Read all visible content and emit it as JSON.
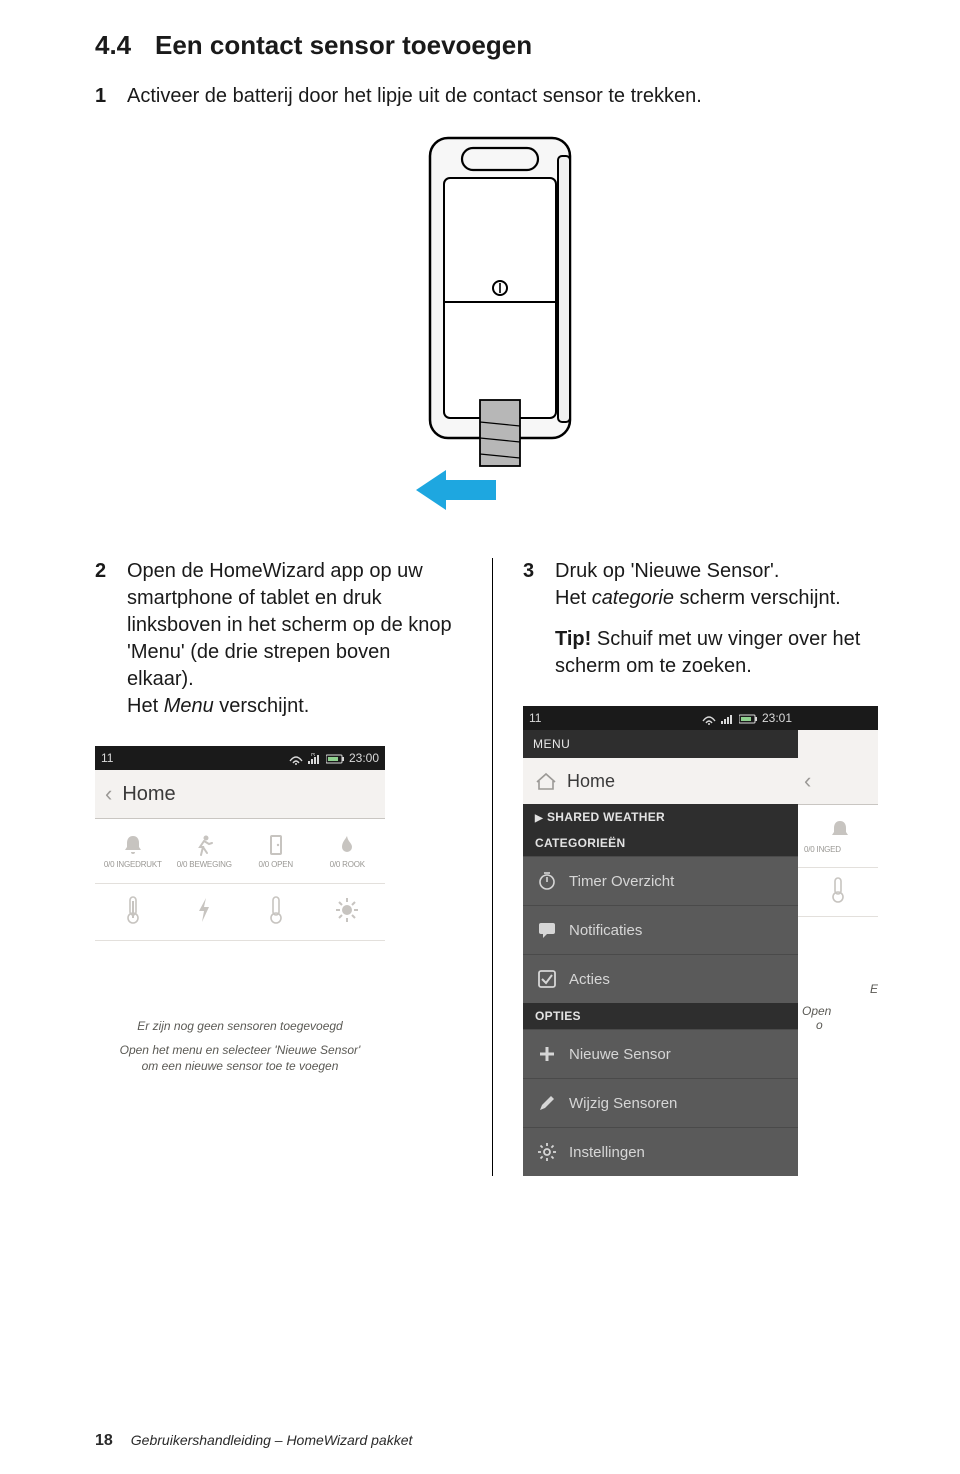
{
  "section": {
    "number": "4.4",
    "title": "Een contact sensor toevoegen"
  },
  "steps": {
    "s1": {
      "num": "1",
      "text": "Activeer de batterij door het lipje uit de contact sensor te trekken."
    },
    "s2": {
      "num": "2",
      "l1a": "Open de HomeWizard app op uw smartphone of tablet en druk linksboven in het scherm op de knop 'Menu' (de drie strepen boven elkaar).",
      "l2a": "Het ",
      "l2b": "Menu",
      "l2c": " verschijnt."
    },
    "s3": {
      "num": "3",
      "l1": "Druk op 'Nieuwe Sensor'.",
      "l2a": "Het ",
      "l2b": "categorie",
      "l2c": " scherm verschijnt.",
      "tip_label": "Tip!",
      "tip_text": " Schuif met uw vinger over het scherm om te zoeken."
    }
  },
  "screenshot_left": {
    "status": {
      "left": "11",
      "time": "23:00"
    },
    "titlebar": {
      "chev": "‹",
      "title": "Home"
    },
    "icons1": {
      "c1": "0/0 INGEDRUKT",
      "c2": "0/0 BEWEGING",
      "c3": "0/0 OPEN",
      "c4": "0/0 ROOK"
    },
    "empty": {
      "l1": "Er zijn nog geen sensoren toegevoegd",
      "l2": "Open het menu en selecteer 'Nieuwe Sensor' om een nieuwe sensor toe te voegen"
    }
  },
  "screenshot_right": {
    "status": {
      "left": "11",
      "time": "23:01"
    },
    "menu_header": "MENU",
    "home": "Home",
    "sect_shared": "SHARED WEATHER",
    "sect_cat": "CATEGORIEËN",
    "items_cat": {
      "timer": "Timer Overzicht",
      "notif": "Notificaties",
      "acties": "Acties"
    },
    "sect_opt": "OPTIES",
    "items_opt": {
      "nieuwe": "Nieuwe Sensor",
      "wijzig": "Wijzig Sensoren",
      "inst": "Instellingen"
    },
    "peek": {
      "titlebar_chev": "‹",
      "icon_cap": "0/0 INGED",
      "body1": "E",
      "body2": "Open",
      "body3": "o"
    }
  },
  "footer": {
    "page": "18",
    "text": "Gebruikershandleiding – HomeWizard pakket"
  }
}
